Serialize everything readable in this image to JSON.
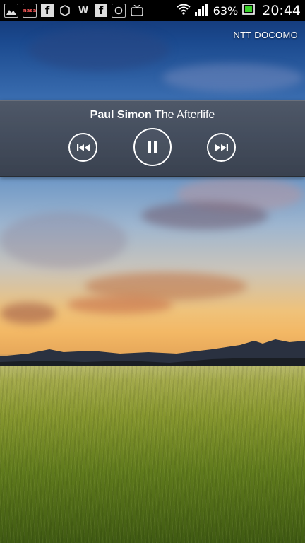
{
  "status_bar": {
    "notification_icons": [
      "gallery-icon",
      "nasatv-icon",
      "facebook-icon",
      "app-icon",
      "walkman-icon",
      "facebook-icon",
      "app-icon",
      "tv-icon"
    ],
    "battery_percent": "63%",
    "time": "20:44"
  },
  "carrier": "NTT DOCOMO",
  "music_widget": {
    "artist": "Paul Simon",
    "title": "The Afterlife"
  },
  "colors": {
    "widget_bg": "#4a5060",
    "battery_green": "#3ad22a"
  }
}
